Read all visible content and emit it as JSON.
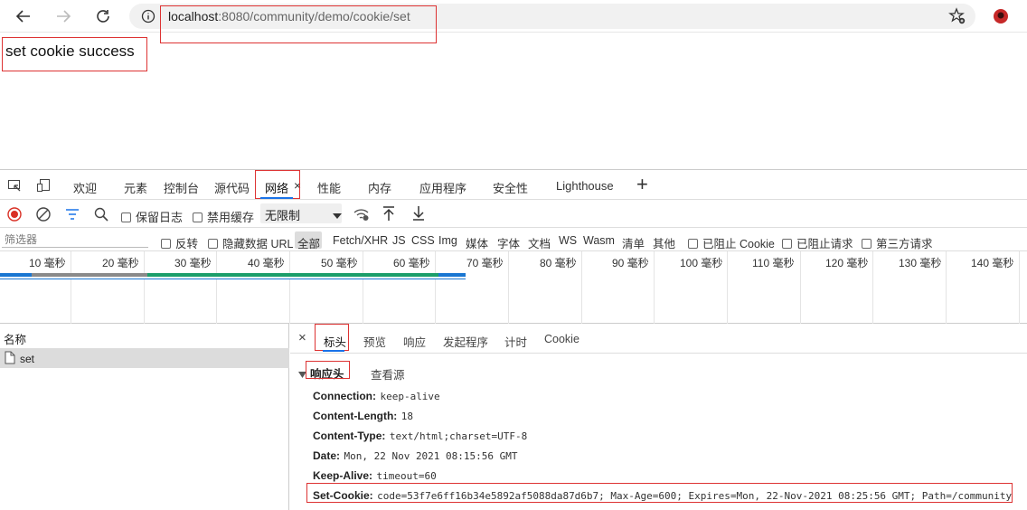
{
  "browser": {
    "url_host": "localhost",
    "url_rest": ":8080/community/demo/cookie/set",
    "icons": [
      "back-arrow-icon",
      "forward-arrow-icon",
      "reload-icon",
      "info-icon",
      "favorite-star-icon",
      "profile-icon"
    ]
  },
  "page": {
    "text": "set cookie success"
  },
  "devtools": {
    "tabs": [
      "欢迎",
      "元素",
      "控制台",
      "源代码",
      "网络",
      "性能",
      "内存",
      "应用程序",
      "安全性",
      "Lighthouse"
    ],
    "active_tab_close": "×",
    "add_tab": "+",
    "toolbar": {
      "preserve_log": "保留日志",
      "disable_cache": "禁用缓存",
      "throttle": "无限制"
    },
    "filter": {
      "placeholder": "筛选器",
      "invert": "反转",
      "hide_data_urls": "隐藏数据 URL",
      "types": [
        "全部",
        "Fetch/XHR",
        "JS",
        "CSS",
        "Img",
        "媒体",
        "字体",
        "文档",
        "WS",
        "Wasm",
        "清单",
        "其他"
      ],
      "blocked_cookies": "已阻止 Cookie",
      "blocked_requests": "已阻止请求",
      "third_party": "第三方请求"
    },
    "timeline": {
      "ticks": [
        "10 毫秒",
        "20 毫秒",
        "30 毫秒",
        "40 毫秒",
        "50 毫秒",
        "60 毫秒",
        "70 毫秒",
        "80 毫秒",
        "90 毫秒",
        "100 毫秒",
        "110 毫秒",
        "120 毫秒",
        "130 毫秒",
        "140 毫秒"
      ]
    },
    "requests": {
      "header": "名称",
      "items": [
        "set"
      ]
    },
    "detail": {
      "close": "×",
      "tabs": [
        "标头",
        "预览",
        "响应",
        "发起程序",
        "计时",
        "Cookie"
      ],
      "section_title": "响应头",
      "view_source": "查看源",
      "headers": [
        {
          "key": "Connection:",
          "value": "keep-alive"
        },
        {
          "key": "Content-Length:",
          "value": "18"
        },
        {
          "key": "Content-Type:",
          "value": "text/html;charset=UTF-8"
        },
        {
          "key": "Date:",
          "value": "Mon, 22 Nov 2021 08:15:56 GMT"
        },
        {
          "key": "Keep-Alive:",
          "value": "timeout=60"
        },
        {
          "key": "Set-Cookie:",
          "value": "code=53f7e6ff16b34e5892af5088da87d6b7; Max-Age=600; Expires=Mon, 22-Nov-2021 08:25:56 GMT; Path=/community"
        }
      ]
    }
  }
}
